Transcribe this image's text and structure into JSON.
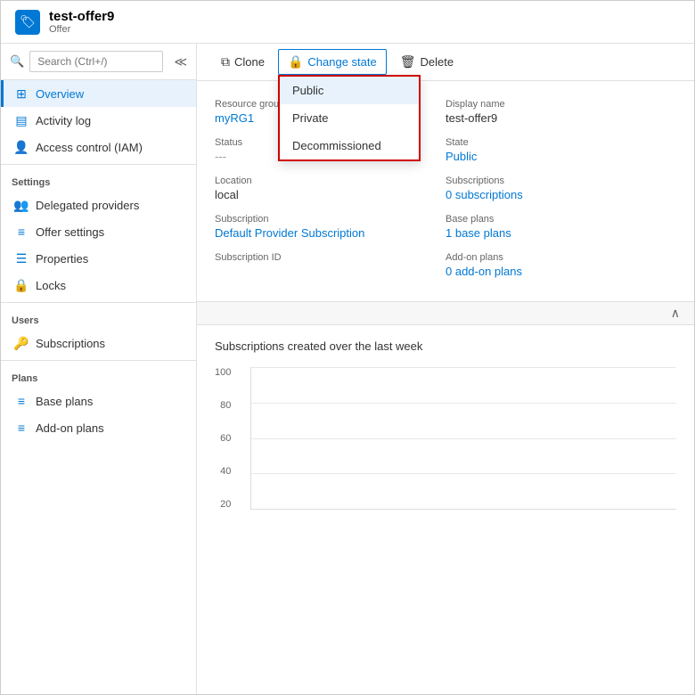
{
  "header": {
    "icon": "🏷",
    "title": "test-offer9",
    "subtitle": "Offer"
  },
  "sidebar": {
    "search_placeholder": "Search (Ctrl+/)",
    "items": [
      {
        "id": "overview",
        "label": "Overview",
        "icon": "overview",
        "active": true
      },
      {
        "id": "activity-log",
        "label": "Activity log",
        "icon": "activity",
        "active": false
      },
      {
        "id": "access-control",
        "label": "Access control (IAM)",
        "icon": "access",
        "active": false
      }
    ],
    "sections": [
      {
        "label": "Settings",
        "items": [
          {
            "id": "delegated-providers",
            "label": "Delegated providers",
            "icon": "delegated"
          },
          {
            "id": "offer-settings",
            "label": "Offer settings",
            "icon": "settings"
          },
          {
            "id": "properties",
            "label": "Properties",
            "icon": "properties"
          },
          {
            "id": "locks",
            "label": "Locks",
            "icon": "locks"
          }
        ]
      },
      {
        "label": "Users",
        "items": [
          {
            "id": "subscriptions",
            "label": "Subscriptions",
            "icon": "subscriptions"
          }
        ]
      },
      {
        "label": "Plans",
        "items": [
          {
            "id": "base-plans",
            "label": "Base plans",
            "icon": "base-plans"
          },
          {
            "id": "add-on-plans",
            "label": "Add-on plans",
            "icon": "add-on-plans"
          }
        ]
      }
    ]
  },
  "toolbar": {
    "clone_label": "Clone",
    "change_state_label": "Change state",
    "delete_label": "Delete"
  },
  "dropdown": {
    "items": [
      {
        "id": "public",
        "label": "Public",
        "selected": true
      },
      {
        "id": "private",
        "label": "Private",
        "selected": false
      },
      {
        "id": "decommissioned",
        "label": "Decommissioned",
        "selected": false
      }
    ]
  },
  "details": {
    "left": [
      {
        "label": "Resource group",
        "value": "myRG1",
        "isLink": true
      },
      {
        "label": "Status",
        "value": "---",
        "isDash": true
      },
      {
        "label": "Location",
        "value": "local",
        "isLink": false
      },
      {
        "label": "Subscription",
        "value": "Default Provider Subscription",
        "isLink": true
      },
      {
        "label": "Subscription ID",
        "value": "",
        "isLink": false
      }
    ],
    "right": [
      {
        "label": "Display name",
        "value": "test-offer9",
        "isLink": false
      },
      {
        "label": "State",
        "value": "Public",
        "isLink": true
      },
      {
        "label": "Subscriptions",
        "value": "0 subscriptions",
        "isLink": true
      },
      {
        "label": "Base plans",
        "value": "1 base plans",
        "isLink": true
      },
      {
        "label": "Add-on plans",
        "value": "0 add-on plans",
        "isLink": true
      }
    ]
  },
  "chart": {
    "title": "Subscriptions created over the last week",
    "y_labels": [
      "100",
      "80",
      "60",
      "40",
      "20"
    ]
  }
}
